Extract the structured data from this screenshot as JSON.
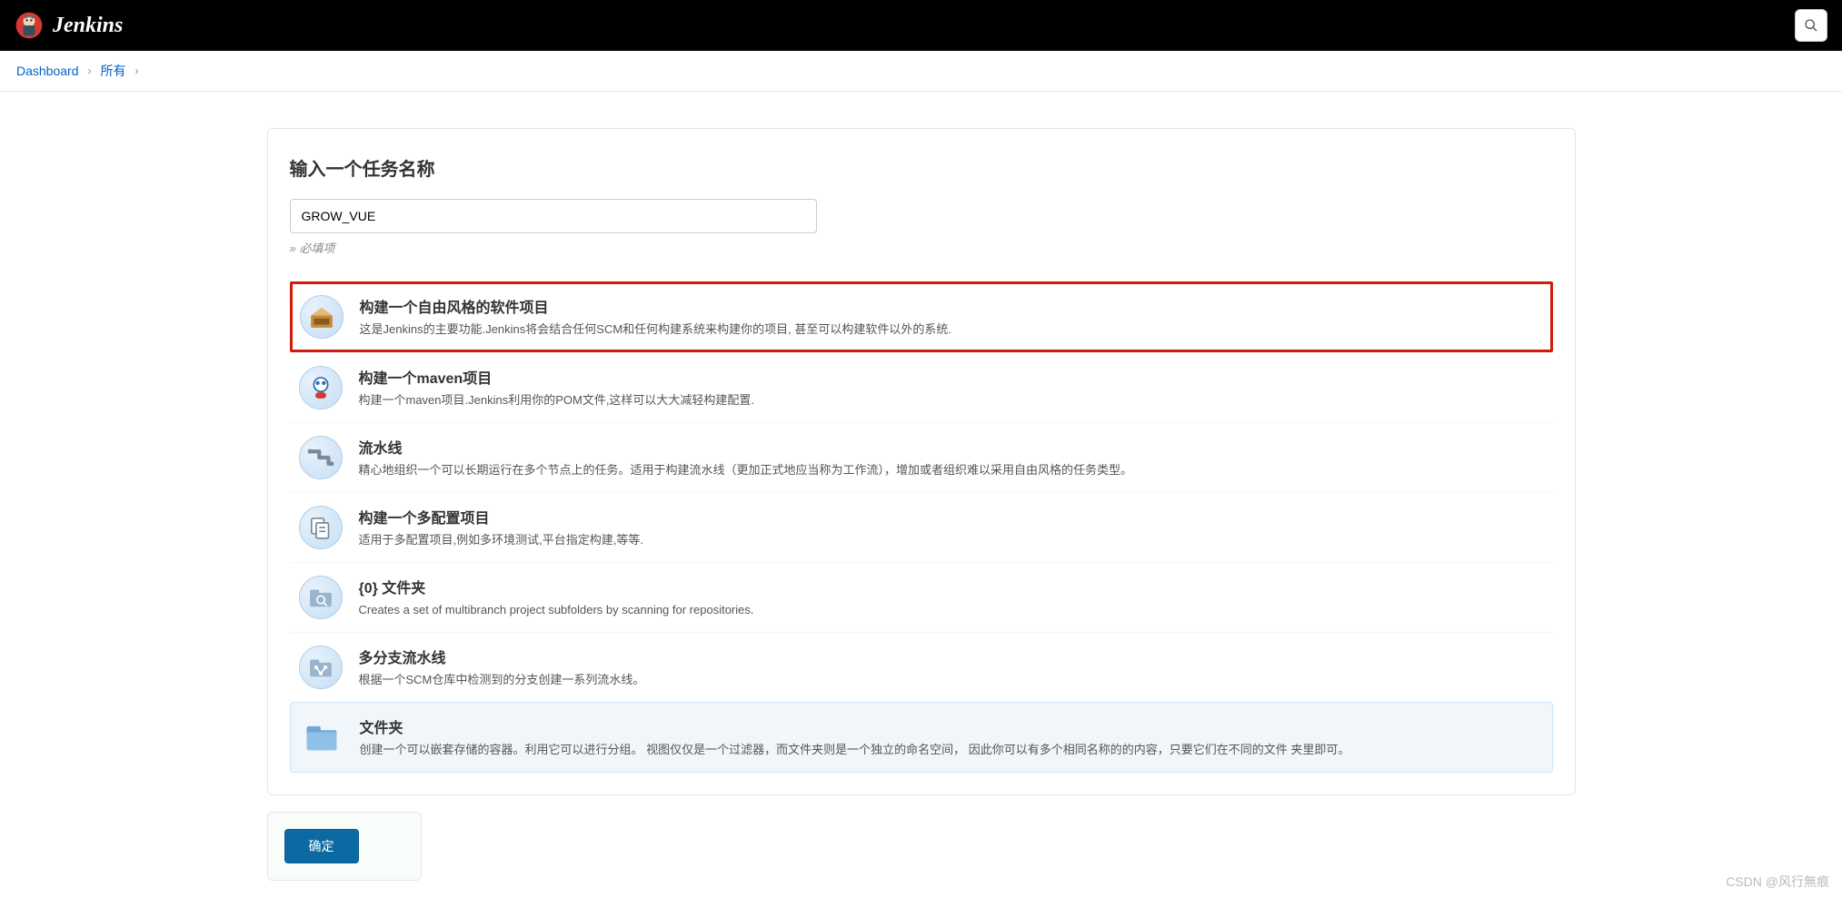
{
  "header": {
    "brand": "Jenkins"
  },
  "breadcrumb": {
    "items": [
      "Dashboard",
      "所有"
    ]
  },
  "form": {
    "title": "输入一个任务名称",
    "value": "GROW_VUE",
    "hint": "» 必填项"
  },
  "items": [
    {
      "title": "构建一个自由风格的软件项目",
      "desc": "这是Jenkins的主要功能.Jenkins将会结合任何SCM和任何构建系统来构建你的项目, 甚至可以构建软件以外的系统.",
      "highlight": true
    },
    {
      "title": "构建一个maven项目",
      "desc": "构建一个maven项目.Jenkins利用你的POM文件,这样可以大大减轻构建配置."
    },
    {
      "title": "流水线",
      "desc": "精心地组织一个可以长期运行在多个节点上的任务。适用于构建流水线（更加正式地应当称为工作流），增加或者组织难以采用自由风格的任务类型。"
    },
    {
      "title": "构建一个多配置项目",
      "desc": "适用于多配置项目,例如多环境测试,平台指定构建,等等."
    },
    {
      "title": "{0} 文件夹",
      "desc": "Creates a set of multibranch project subfolders by scanning for repositories."
    },
    {
      "title": "多分支流水线",
      "desc": "根据一个SCM仓库中检测到的分支创建一系列流水线。"
    },
    {
      "title": "文件夹",
      "desc": "创建一个可以嵌套存储的容器。利用它可以进行分组。 视图仅仅是一个过滤器，而文件夹则是一个独立的命名空间， 因此你可以有多个相同名称的的内容，只要它们在不同的文件 夹里即可。",
      "selected": true
    }
  ],
  "footer": {
    "ok": "确定"
  },
  "watermark": "CSDN @风行無痕"
}
